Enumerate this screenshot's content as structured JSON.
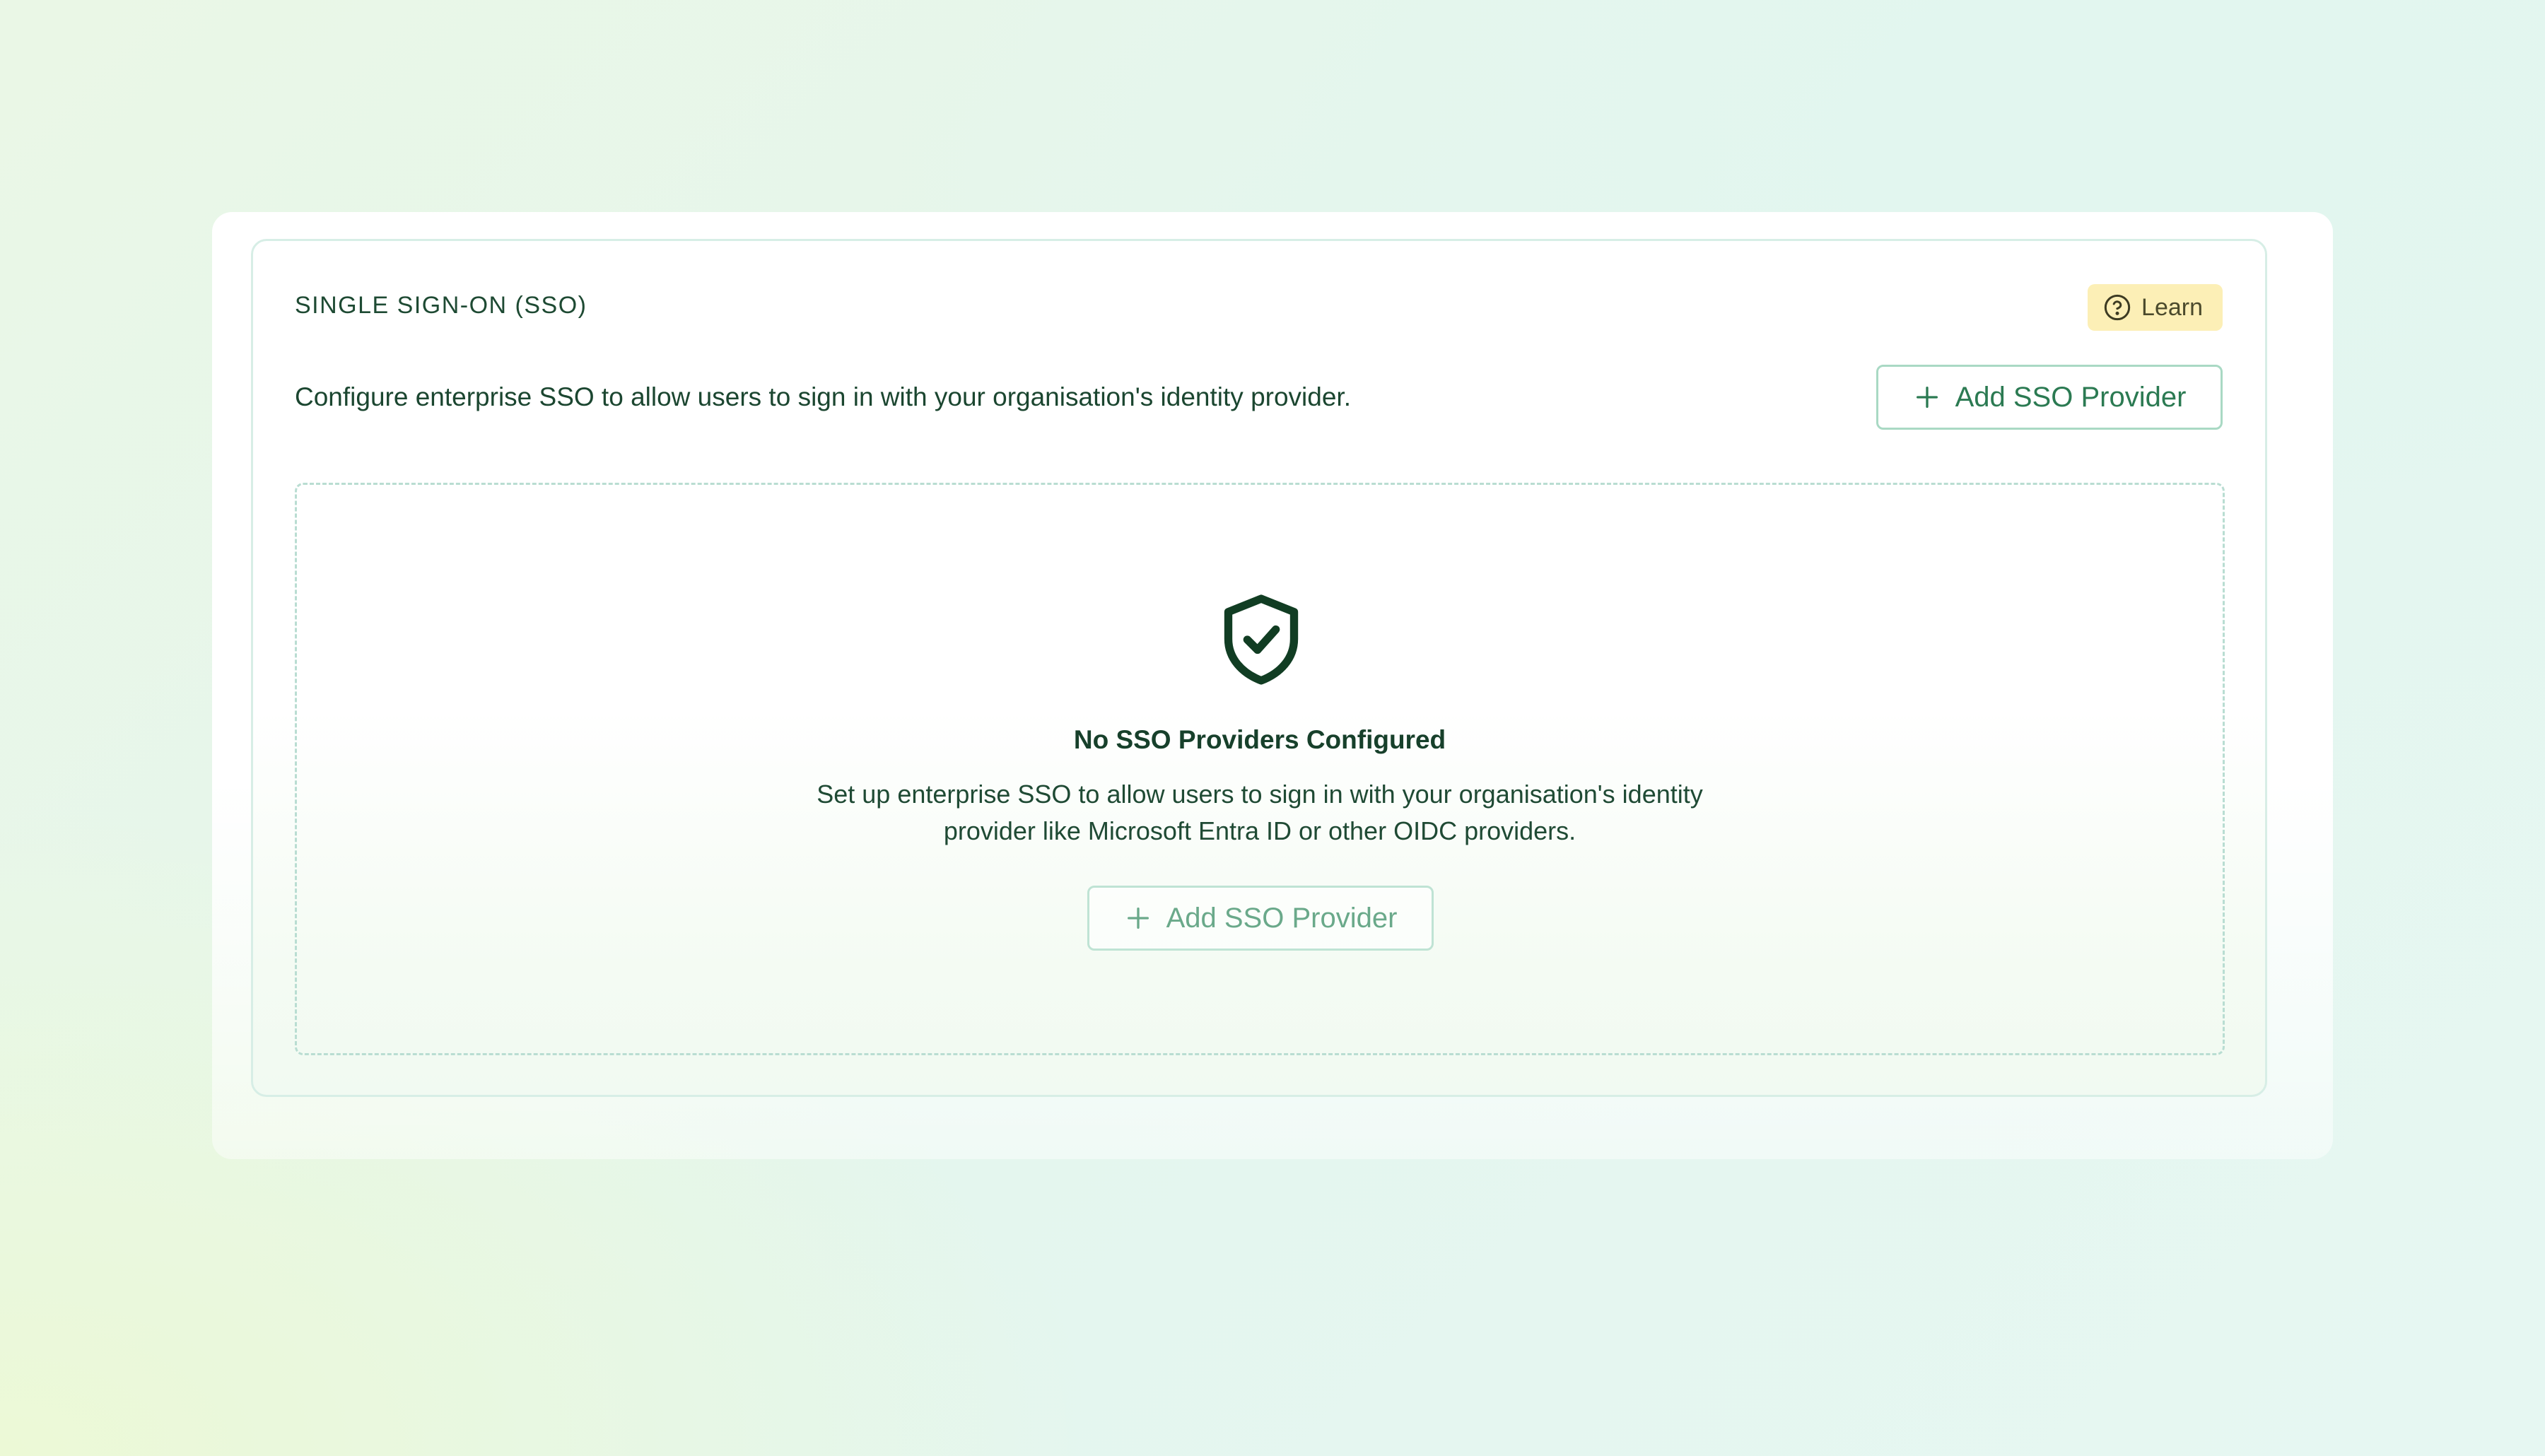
{
  "section": {
    "title": "SINGLE SIGN-ON (SSO)",
    "learn_label": "Learn",
    "description": "Configure enterprise SSO to allow users to sign in with your organisation's identity provider.",
    "add_button_label": "Add SSO Provider"
  },
  "empty_state": {
    "title": "No SSO Providers Configured",
    "description_line1": "Set up enterprise SSO to allow users to sign in with your organisation's identity",
    "description_line2": "provider like Microsoft Entra ID or other OIDC providers.",
    "add_button_label": "Add SSO Provider"
  },
  "icons": {
    "learn": "help-circle-icon",
    "add": "plus-icon",
    "empty": "shield-check-icon"
  },
  "colors": {
    "accent": "#2b7a52",
    "icon_dark": "#113d23",
    "learn_bg": "#fcefb6",
    "border": "#a9d9c4"
  }
}
